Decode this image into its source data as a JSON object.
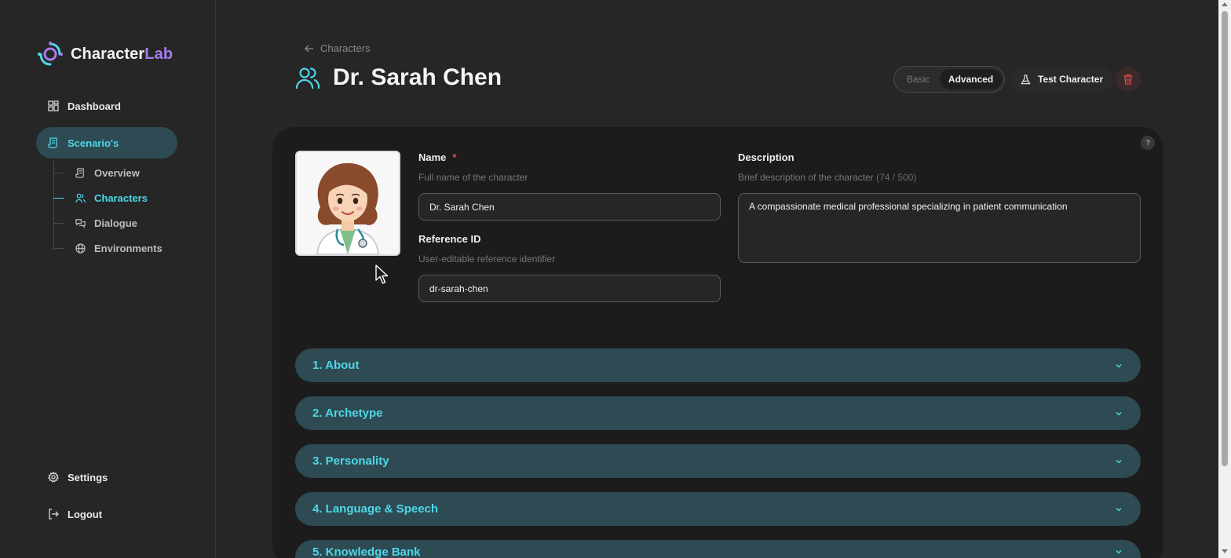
{
  "app": {
    "logo_main": "Character",
    "logo_accent": "Lab"
  },
  "sidebar": {
    "items": [
      {
        "label": "Dashboard",
        "icon": "dashboard-grid-icon"
      },
      {
        "label": "Scenario's",
        "icon": "scroll-icon"
      }
    ],
    "sub_items": [
      {
        "label": "Overview",
        "icon": "scroll-icon"
      },
      {
        "label": "Characters",
        "icon": "users-icon"
      },
      {
        "label": "Dialogue",
        "icon": "chat-bubbles-icon"
      },
      {
        "label": "Environments",
        "icon": "globe-icon"
      }
    ],
    "settings_label": "Settings",
    "logout_label": "Logout"
  },
  "header": {
    "breadcrumb": "Characters",
    "title": "Dr. Sarah Chen",
    "toggle_basic": "Basic",
    "toggle_advanced": "Advanced",
    "test_label": "Test Character",
    "help": "?"
  },
  "form": {
    "name_label": "Name",
    "name_required": "*",
    "name_hint": "Full name of the character",
    "name_value": "Dr. Sarah Chen",
    "ref_label": "Reference ID",
    "ref_hint": "User-editable reference identifier",
    "ref_value": "dr-sarah-chen",
    "desc_label": "Description",
    "desc_hint": "Brief description of the character",
    "desc_count": "(74 / 500)",
    "desc_value": "A compassionate medical professional specializing in patient communication"
  },
  "sections": [
    "1. About",
    "2. Archetype",
    "3. Personality",
    "4. Language & Speech",
    "5. Knowledge Bank"
  ],
  "colors": {
    "accent": "#4dd7e8",
    "active_bg": "#2e4a52",
    "logo_accent": "#a77bf0",
    "danger": "#e04b4b"
  }
}
